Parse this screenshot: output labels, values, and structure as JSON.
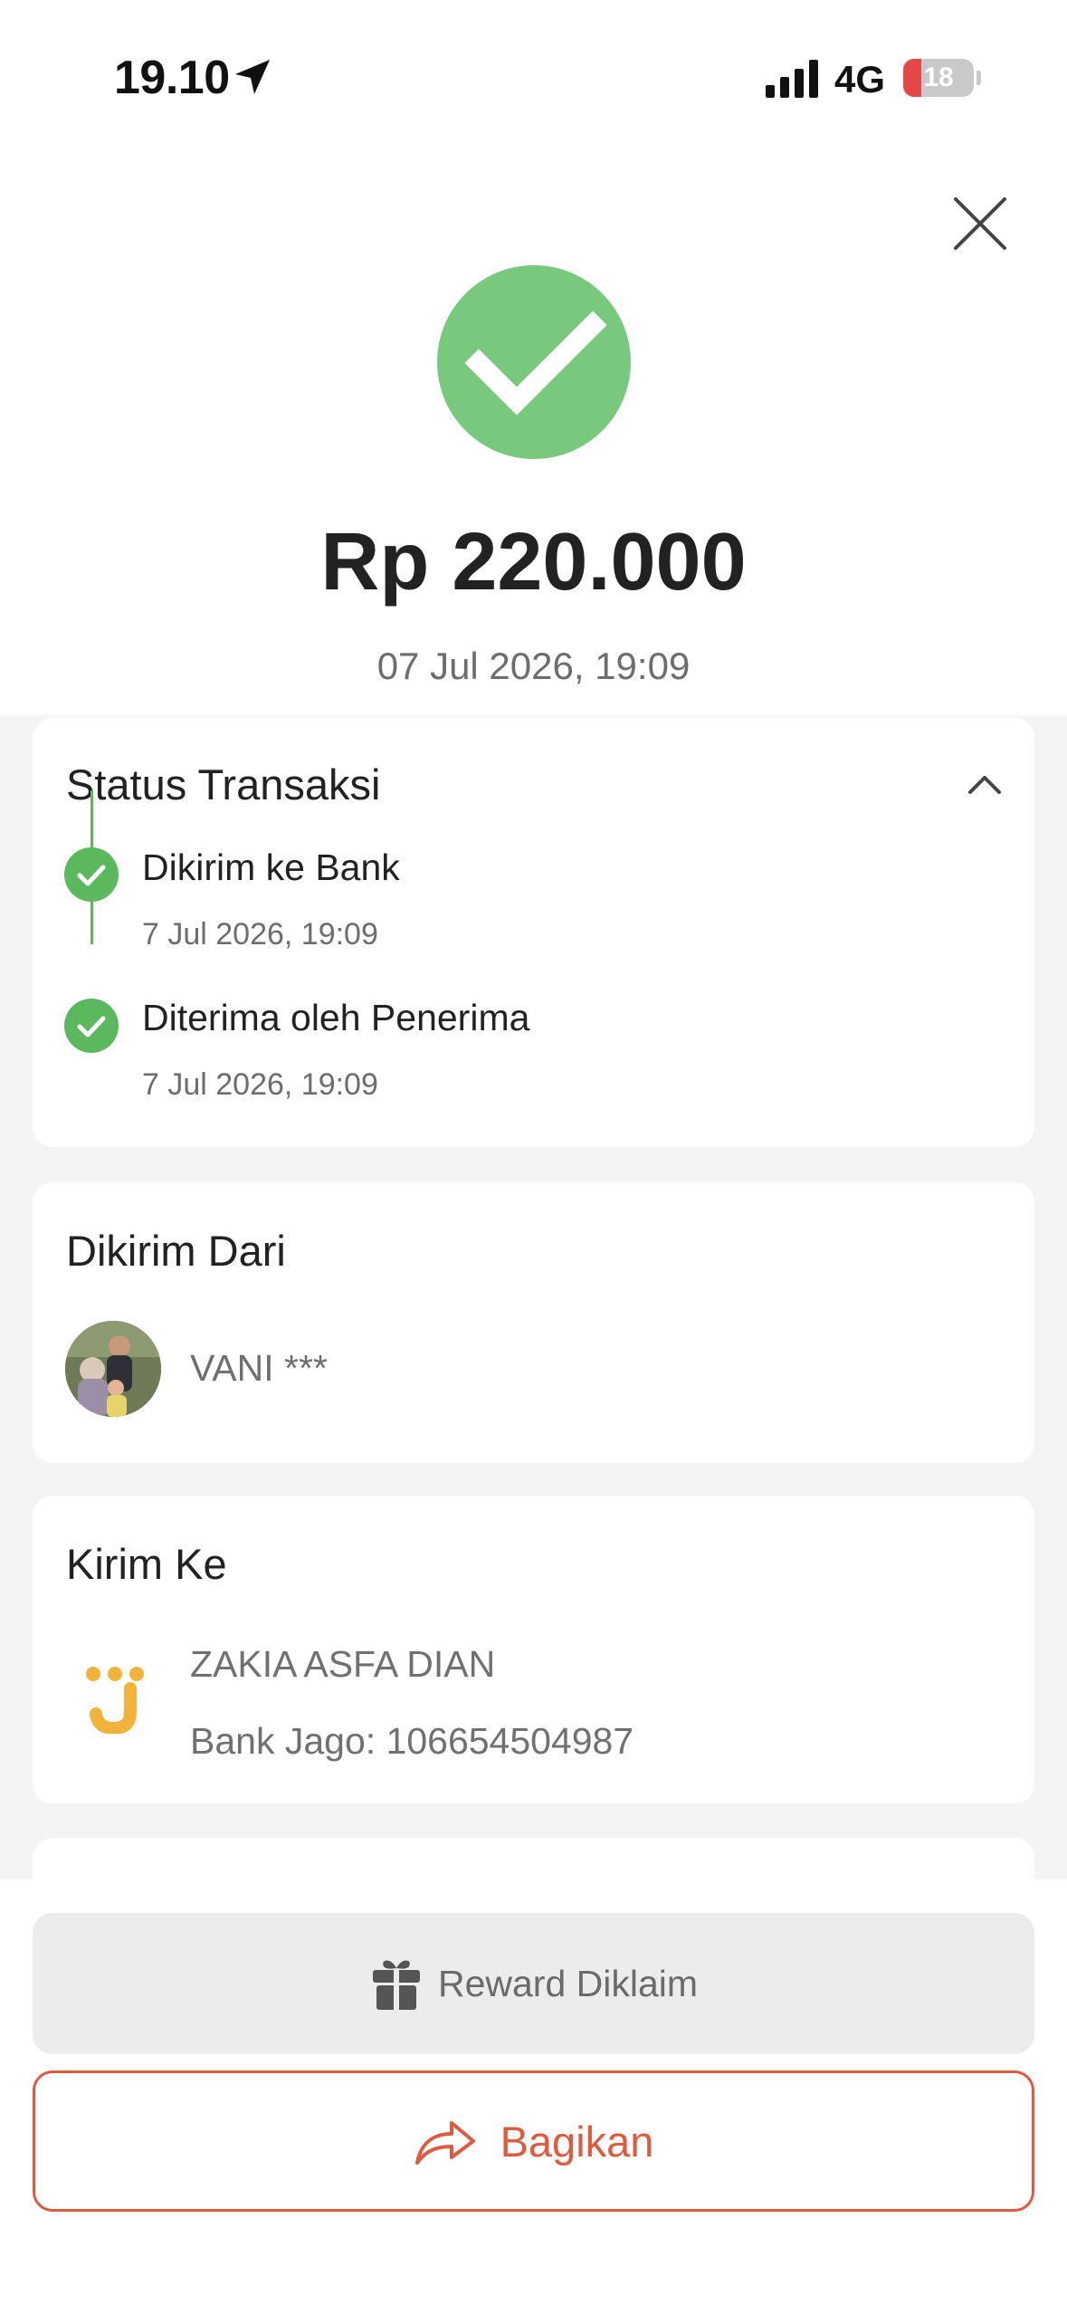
{
  "status_bar": {
    "time": "19.10",
    "network": "4G",
    "battery_level": "18"
  },
  "header": {
    "amount": "Rp 220.000",
    "datetime": "07 Jul 2026, 19:09"
  },
  "status_card": {
    "title": "Status Transaksi",
    "steps": [
      {
        "label": "Dikirim ke Bank",
        "time": "7 Jul 2026, 19:09"
      },
      {
        "label": "Diterima oleh Penerima",
        "time": "7 Jul 2026, 19:09"
      }
    ]
  },
  "sender_card": {
    "title": "Dikirim Dari",
    "name": "VANI ***"
  },
  "recipient_card": {
    "title": "Kirim Ke",
    "name": "ZAKIA ASFA DIAN",
    "account": "Bank Jago: 106654504987"
  },
  "actions": {
    "reward_label": "Reward Diklaim",
    "share_label": "Bagikan"
  },
  "colors": {
    "success": "#78c97e",
    "timeline": "#5cb85c",
    "accent": "#e05a3f",
    "bank_logo": "#f2b33d"
  }
}
